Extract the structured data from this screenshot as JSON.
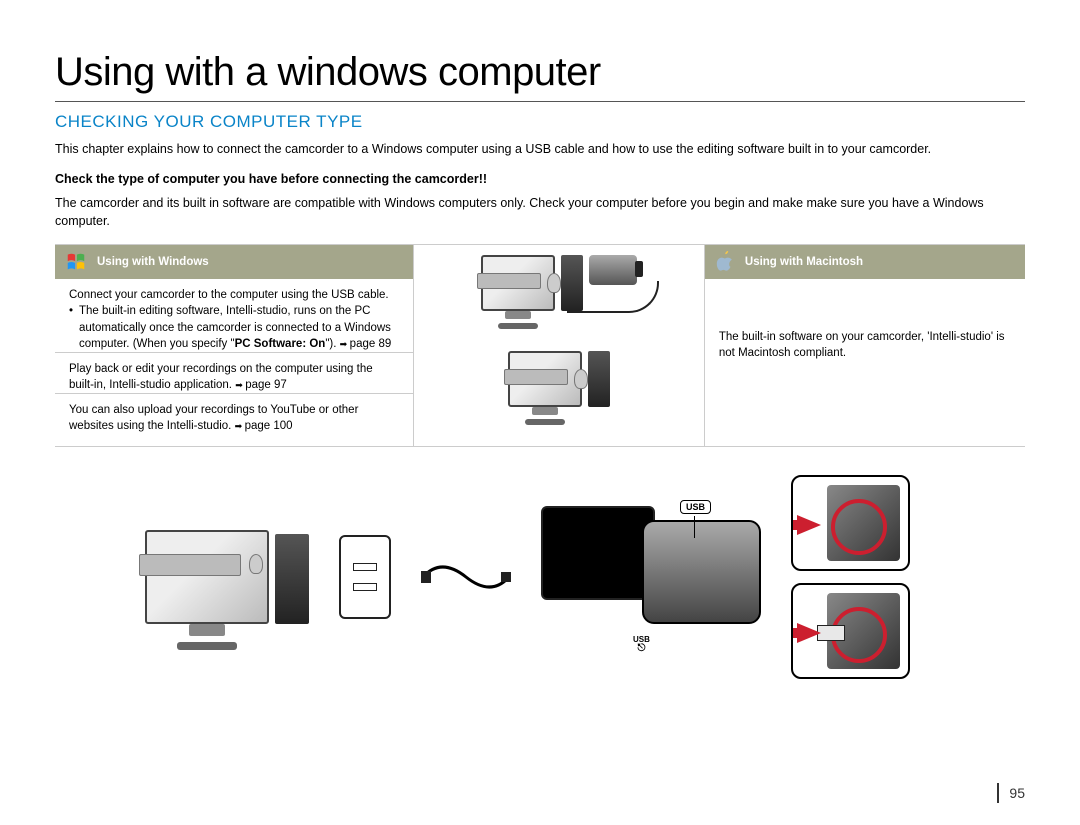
{
  "title": "Using with a windows computer",
  "section_heading": "CHECKING YOUR COMPUTER TYPE",
  "intro": "This chapter explains how to connect the camcorder to a Windows computer using a USB cable and how to use the editing software built in to your camcorder.",
  "check_bold": "Check the type of computer you have before connecting the camcorder!!",
  "check_body": "The camcorder and its built in software are compatible with Windows computers only. Check your computer before you begin and make make sure you have a Windows computer.",
  "windows_col": {
    "header": "Using with Windows",
    "row1_lead": "Connect your camcorder to the computer using the USB cable.",
    "row1_bullet_pre": "The built-in editing software, Intelli-studio, runs on the PC automatically once the camcorder is connected to a Windows computer. (When you specify \"",
    "row1_bullet_bold": "PC Software: On",
    "row1_bullet_post": "\"). ",
    "row1_page_ref": "page 89",
    "row2": "Play back or edit your recordings on the computer using the built-in, Intelli-studio application. ",
    "row2_page_ref": "page 97",
    "row3": "You can also upload your recordings to YouTube or other websites using the Intelli-studio. ",
    "row3_page_ref": "page 100"
  },
  "mac_col": {
    "header": "Using with Macintosh",
    "body": "The built-in software on your camcorder, 'Intelli-studio' is not Macintosh compliant."
  },
  "diagram": {
    "usb_label": "USB",
    "usb_small": "USB"
  },
  "page_number": "95"
}
